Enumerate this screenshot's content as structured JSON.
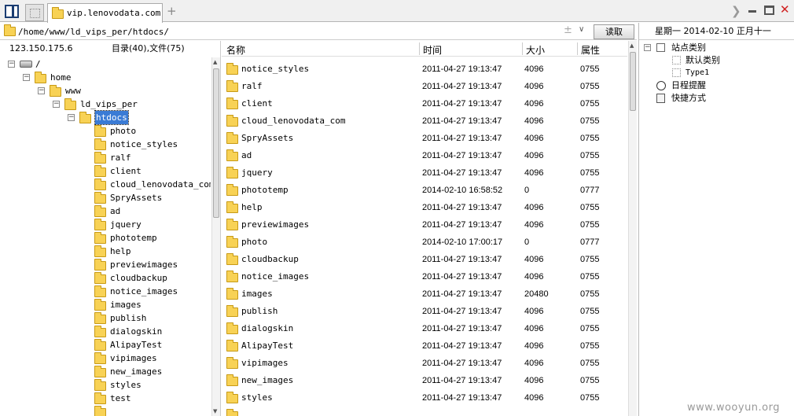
{
  "tab": {
    "title": "vip.lenovodata.com"
  },
  "address": {
    "path": "/home/www/ld_vips_per/htdocs/",
    "read_label": "读取"
  },
  "left_info": {
    "ip": "123.150.175.6",
    "counts": "目录(40),文件(75)"
  },
  "tree": [
    {
      "label": "/",
      "depth": 0,
      "expander": "−",
      "icon": "drive"
    },
    {
      "label": "home",
      "depth": 1,
      "expander": "−",
      "icon": "folder"
    },
    {
      "label": "www",
      "depth": 2,
      "expander": "−",
      "icon": "folder"
    },
    {
      "label": "ld_vips_per",
      "depth": 3,
      "expander": "−",
      "icon": "folder"
    },
    {
      "label": "htdocs",
      "depth": 4,
      "expander": "−",
      "icon": "folder",
      "selected": true
    },
    {
      "label": "photo",
      "depth": 5,
      "icon": "folder"
    },
    {
      "label": "notice_styles",
      "depth": 5,
      "icon": "folder"
    },
    {
      "label": "ralf",
      "depth": 5,
      "icon": "folder"
    },
    {
      "label": "client",
      "depth": 5,
      "icon": "folder"
    },
    {
      "label": "cloud_lenovodata_com",
      "depth": 5,
      "icon": "folder"
    },
    {
      "label": "SpryAssets",
      "depth": 5,
      "icon": "folder"
    },
    {
      "label": "ad",
      "depth": 5,
      "icon": "folder"
    },
    {
      "label": "jquery",
      "depth": 5,
      "icon": "folder"
    },
    {
      "label": "phototemp",
      "depth": 5,
      "icon": "folder"
    },
    {
      "label": "help",
      "depth": 5,
      "icon": "folder"
    },
    {
      "label": "previewimages",
      "depth": 5,
      "icon": "folder"
    },
    {
      "label": "cloudbackup",
      "depth": 5,
      "icon": "folder"
    },
    {
      "label": "notice_images",
      "depth": 5,
      "icon": "folder"
    },
    {
      "label": "images",
      "depth": 5,
      "icon": "folder"
    },
    {
      "label": "publish",
      "depth": 5,
      "icon": "folder"
    },
    {
      "label": "dialogskin",
      "depth": 5,
      "icon": "folder"
    },
    {
      "label": "AlipayTest",
      "depth": 5,
      "icon": "folder"
    },
    {
      "label": "vipimages",
      "depth": 5,
      "icon": "folder"
    },
    {
      "label": "new_images",
      "depth": 5,
      "icon": "folder"
    },
    {
      "label": "styles",
      "depth": 5,
      "icon": "folder"
    },
    {
      "label": "test",
      "depth": 5,
      "icon": "folder"
    },
    {
      "label": "",
      "depth": 5,
      "icon": "folder"
    }
  ],
  "columns": {
    "name": "名称",
    "time": "时间",
    "size": "大小",
    "attr": "属性"
  },
  "files": [
    {
      "name": "notice_styles",
      "time": "2011-04-27 19:13:47",
      "size": "4096",
      "attr": "0755"
    },
    {
      "name": "ralf",
      "time": "2011-04-27 19:13:47",
      "size": "4096",
      "attr": "0755"
    },
    {
      "name": "client",
      "time": "2011-04-27 19:13:47",
      "size": "4096",
      "attr": "0755"
    },
    {
      "name": "cloud_lenovodata_com",
      "time": "2011-04-27 19:13:47",
      "size": "4096",
      "attr": "0755"
    },
    {
      "name": "SpryAssets",
      "time": "2011-04-27 19:13:47",
      "size": "4096",
      "attr": "0755"
    },
    {
      "name": "ad",
      "time": "2011-04-27 19:13:47",
      "size": "4096",
      "attr": "0755"
    },
    {
      "name": "jquery",
      "time": "2011-04-27 19:13:47",
      "size": "4096",
      "attr": "0755"
    },
    {
      "name": "phototemp",
      "time": "2014-02-10 16:58:52",
      "size": "0",
      "attr": "0777"
    },
    {
      "name": "help",
      "time": "2011-04-27 19:13:47",
      "size": "4096",
      "attr": "0755"
    },
    {
      "name": "previewimages",
      "time": "2011-04-27 19:13:47",
      "size": "4096",
      "attr": "0755"
    },
    {
      "name": "photo",
      "time": "2014-02-10 17:00:17",
      "size": "0",
      "attr": "0777"
    },
    {
      "name": "cloudbackup",
      "time": "2011-04-27 19:13:47",
      "size": "4096",
      "attr": "0755"
    },
    {
      "name": "notice_images",
      "time": "2011-04-27 19:13:47",
      "size": "4096",
      "attr": "0755"
    },
    {
      "name": "images",
      "time": "2011-04-27 19:13:47",
      "size": "20480",
      "attr": "0755"
    },
    {
      "name": "publish",
      "time": "2011-04-27 19:13:47",
      "size": "4096",
      "attr": "0755"
    },
    {
      "name": "dialogskin",
      "time": "2011-04-27 19:13:47",
      "size": "4096",
      "attr": "0755"
    },
    {
      "name": "AlipayTest",
      "time": "2011-04-27 19:13:47",
      "size": "4096",
      "attr": "0755"
    },
    {
      "name": "vipimages",
      "time": "2011-04-27 19:13:47",
      "size": "4096",
      "attr": "0755"
    },
    {
      "name": "new_images",
      "time": "2011-04-27 19:13:47",
      "size": "4096",
      "attr": "0755"
    },
    {
      "name": "styles",
      "time": "2011-04-27 19:13:47",
      "size": "4096",
      "attr": "0755"
    },
    {
      "name": "",
      "time": "",
      "size": "",
      "attr": ""
    }
  ],
  "right_panel": {
    "date": "星期一  2014-02-10  正月十一",
    "site_category": "站点类别",
    "default_category": "默认类别",
    "type1": "Type1",
    "schedule": "日程提醒",
    "shortcuts": "快捷方式"
  },
  "watermark": "www.wooyun.org"
}
